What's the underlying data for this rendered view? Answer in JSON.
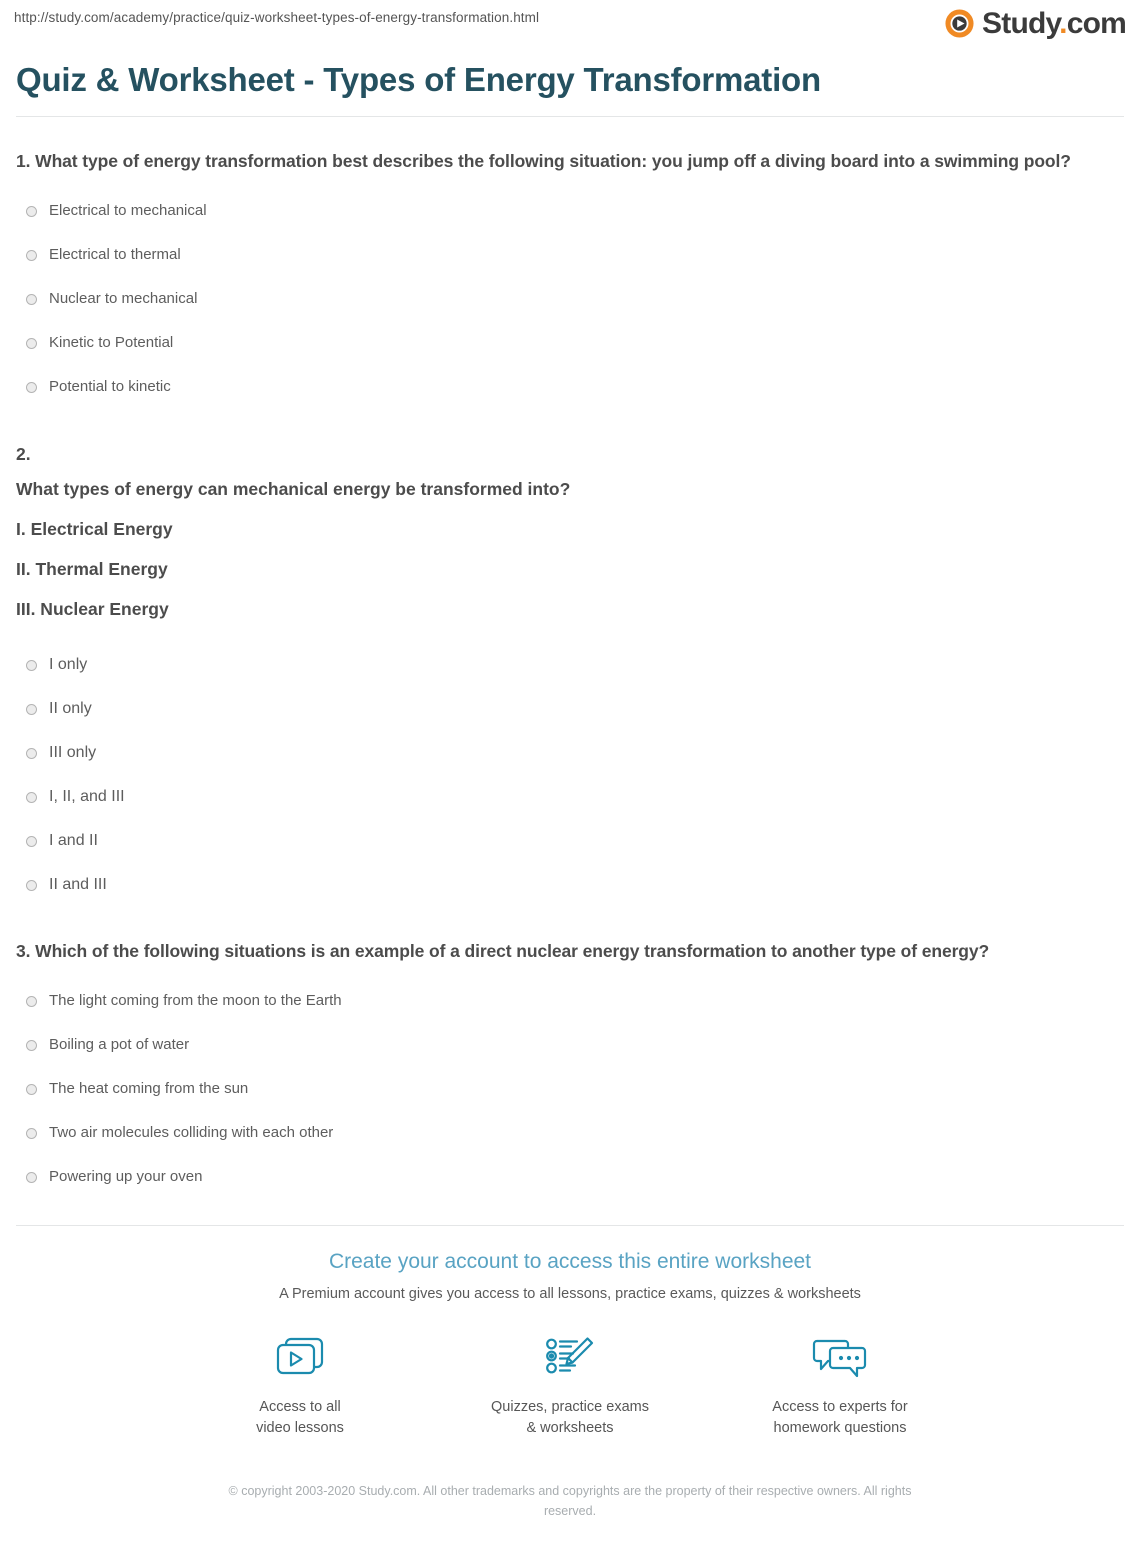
{
  "browser": {
    "url": "http://study.com/academy/practice/quiz-worksheet-types-of-energy-transformation.html"
  },
  "brand": {
    "name": "Study",
    "dot": ".",
    "tld": "com",
    "logo_icon": "play-circle-icon",
    "accent_teal": "#1b9bc4",
    "accent_orange": "#f08a24"
  },
  "page": {
    "title": "Quiz & Worksheet - Types of Energy Transformation",
    "title_color": "#255160"
  },
  "questions": [
    {
      "number": "1.",
      "prompt": "1. What type of energy transformation best describes the following situation: you jump off a diving board into a swimming pool?",
      "options": [
        "Electrical to mechanical",
        "Electrical to thermal",
        "Nuclear to mechanical",
        "Kinetic to Potential",
        "Potential to kinetic"
      ]
    },
    {
      "number": "2.",
      "prompt": "What types of energy can mechanical energy be transformed into?",
      "roman_items": [
        "I. Electrical Energy",
        "II. Thermal Energy",
        "III. Nuclear Energy"
      ],
      "options": [
        "I only",
        "II only",
        "III only",
        "I, II, and III",
        "I and II",
        "II and III"
      ]
    },
    {
      "number": "3.",
      "prompt": "3. Which of the following situations is an example of a direct nuclear energy transformation to another type of energy?",
      "options": [
        "The light coming from the moon to the Earth",
        "Boiling a pot of water",
        "The heat coming from the sun",
        "Two air molecules colliding with each other",
        "Powering up your oven"
      ]
    }
  ],
  "cta": {
    "heading": "Create your account to access this entire worksheet",
    "subheading": "A Premium account gives you access to all lessons, practice exams, quizzes & worksheets",
    "heading_color": "#59a3c3",
    "features": [
      {
        "icon": "video-lessons-icon",
        "label": "Access to all\nvideo lessons"
      },
      {
        "icon": "quiz-checklist-pencil-icon",
        "label": "Quizzes, practice exams\n& worksheets"
      },
      {
        "icon": "chat-bubbles-icon",
        "label": "Access to experts for\nhomework questions"
      }
    ]
  },
  "footer": {
    "copyright": "© copyright 2003-2020 Study.com. All other trademarks and copyrights are the property of their respective owners. All rights reserved."
  }
}
